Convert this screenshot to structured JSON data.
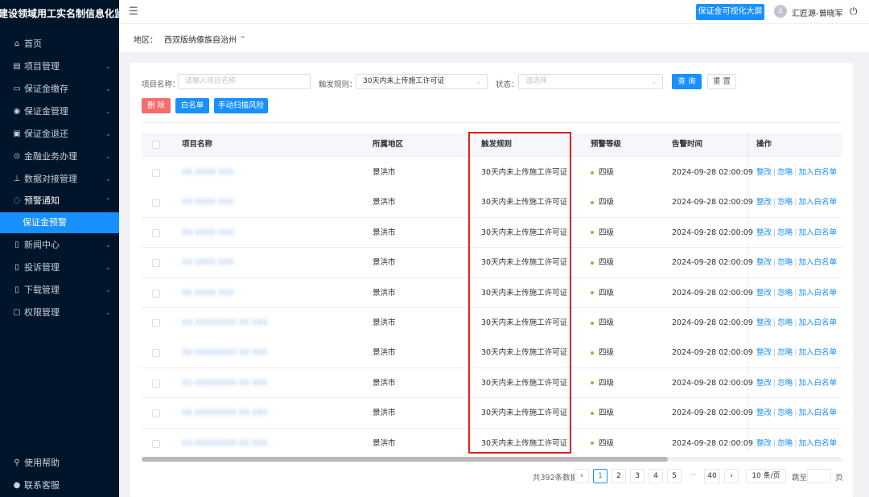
{
  "app": {
    "title": "建设领域用工实名制信息化监督平台"
  },
  "sidebar": {
    "items": [
      {
        "label": "首页",
        "icon": "⌂",
        "icon_name": "home-icon",
        "chevron": false
      },
      {
        "label": "项目管理",
        "icon": "▤",
        "icon_name": "project-icon",
        "chevron": true
      },
      {
        "label": "保证金缴存",
        "icon": "▭",
        "icon_name": "deposit-icon",
        "chevron": true
      },
      {
        "label": "保证金管理",
        "icon": "◉",
        "icon_name": "guarantee-icon",
        "chevron": true
      },
      {
        "label": "保证金退还",
        "icon": "▣",
        "icon_name": "refund-icon",
        "chevron": true
      },
      {
        "label": "金融业务办理",
        "icon": "⊙",
        "icon_name": "finance-icon",
        "chevron": true
      },
      {
        "label": "数据对接管理",
        "icon": "⊥",
        "icon_name": "data-icon",
        "chevron": true
      },
      {
        "label": "预警通知",
        "icon": "◌",
        "icon_name": "warning-icon",
        "chevron": true,
        "open": true
      },
      {
        "label": "保证金预警",
        "icon": "",
        "icon_name": "",
        "chevron": false,
        "active": true
      },
      {
        "label": "新闻中心",
        "icon": "▯",
        "icon_name": "news-icon",
        "chevron": true
      },
      {
        "label": "投诉管理",
        "icon": "▯",
        "icon_name": "complaint-icon",
        "chevron": true
      },
      {
        "label": "下载管理",
        "icon": "▯",
        "icon_name": "download-icon",
        "chevron": true
      },
      {
        "label": "权限管理",
        "icon": "▢",
        "icon_name": "lock-icon",
        "chevron": true
      }
    ],
    "bottom": [
      {
        "label": "使用帮助",
        "icon": "⚲",
        "icon_name": "help-icon"
      },
      {
        "label": "联系客服",
        "icon": "●",
        "icon_name": "service-icon"
      }
    ]
  },
  "topbar": {
    "screen_button": "保证金可视化大屏",
    "user": "汇匠源-曾晓军"
  },
  "region": {
    "label": "地区：",
    "value": "西双版纳傣族自治州"
  },
  "filters": {
    "name_label": "项目名称：",
    "name_placeholder": "请输入项目名称",
    "rule_label": "触发规则：",
    "rule_value": "30天内未上传施工许可证",
    "status_label": "状态：",
    "status_placeholder": "请选择",
    "search": "查 询",
    "reset": "重 置"
  },
  "actions": {
    "delete": "删 除",
    "whitelist": "白名单",
    "scan": "手动扫描风险"
  },
  "table": {
    "headers": [
      "项目名称",
      "所属地区",
      "触发规则",
      "预警等级",
      "告警时间",
      "操作"
    ],
    "rows": [
      {
        "name": "XX XXXX XXX",
        "region": "景洪市",
        "rule": "30天内未上传施工许可证",
        "level": "四级",
        "time": "2024-09-28 02:00:09"
      },
      {
        "name": "XX XXXX XXX",
        "region": "景洪市",
        "rule": "30天内未上传施工许可证",
        "level": "四级",
        "time": "2024-09-28 02:00:09"
      },
      {
        "name": "XX XXXX XXX",
        "region": "景洪市",
        "rule": "30天内未上传施工许可证",
        "level": "四级",
        "time": "2024-09-28 02:00:09"
      },
      {
        "name": "XX XXXX XXX",
        "region": "景洪市",
        "rule": "30天内未上传施工许可证",
        "level": "四级",
        "time": "2024-09-28 02:00:09"
      },
      {
        "name": "XX XXXX XXX",
        "region": "景洪市",
        "rule": "30天内未上传施工许可证",
        "level": "四级",
        "time": "2024-09-28 02:00:09"
      },
      {
        "name": "XX XXXXXXXX XX XXX",
        "region": "景洪市",
        "rule": "30天内未上传施工许可证",
        "level": "四级",
        "time": "2024-09-28 02:00:09"
      },
      {
        "name": "XX XXXXXXXX XX XXX",
        "region": "景洪市",
        "rule": "30天内未上传施工许可证",
        "level": "四级",
        "time": "2024-09-28 02:00:09"
      },
      {
        "name": "XX XXXXXXXX XX XXX",
        "region": "景洪市",
        "rule": "30天内未上传施工许可证",
        "level": "四级",
        "time": "2024-09-28 02:00:09"
      },
      {
        "name": "XX XXXXXXXX XX XXX",
        "region": "景洪市",
        "rule": "30天内未上传施工许可证",
        "level": "四级",
        "time": "2024-09-28 02:00:09"
      },
      {
        "name": "XX XXXXXXXX XX XXX",
        "region": "景洪市",
        "rule": "30天内未上传施工许可证",
        "level": "四级",
        "time": "2024-09-28 02:00:09"
      }
    ],
    "ops": {
      "edit": "整改",
      "ignore": "忽略",
      "whitelist": "加入白名单"
    }
  },
  "pagination": {
    "total": "共392条数据",
    "prev": "‹",
    "pages": [
      "1",
      "2",
      "3",
      "4",
      "5"
    ],
    "ellipsis": "···",
    "last": "40",
    "next": "›",
    "size": "10 条/页",
    "jump_label": "跳至",
    "jump_suffix": "页"
  },
  "colors": {
    "primary": "#1890ff",
    "sidebar": "#001529",
    "danger": "#f56c6c",
    "highlight": "#e02020"
  }
}
